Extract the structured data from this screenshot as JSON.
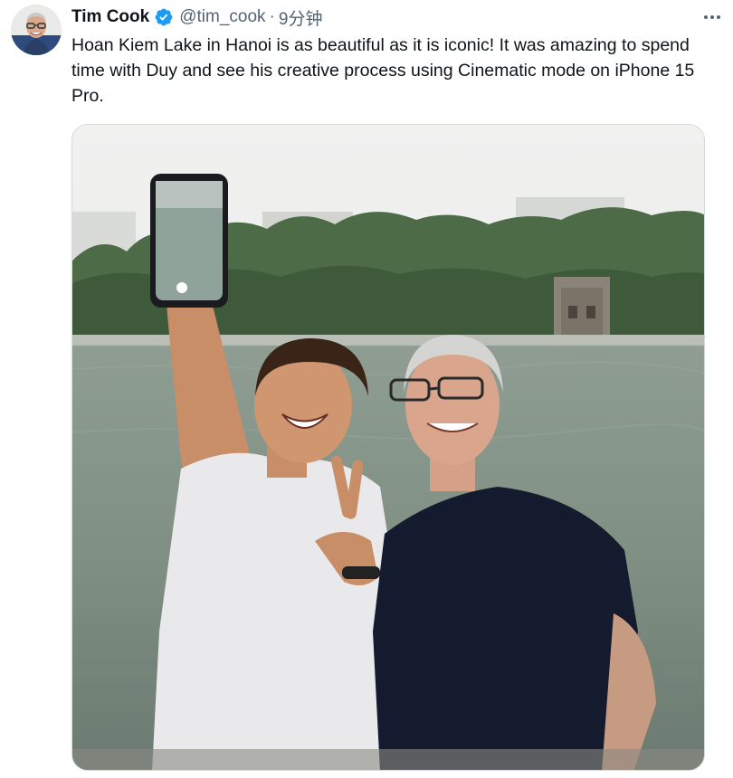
{
  "tweet": {
    "author": {
      "display_name": "Tim Cook",
      "handle": "@tim_cook",
      "verified": true,
      "verified_color": "#1d9bf0"
    },
    "separator": "·",
    "time": "9分钟",
    "text": "Hoan Kiem Lake in Hanoi is as beautiful as it is iconic! It was amazing to spend time with Duy and see his creative process using Cinematic mode on iPhone 15 Pro.",
    "more_icon": "ellipsis-icon"
  },
  "colors": {
    "text_primary": "#0f1419",
    "text_secondary": "#536471",
    "border": "#cfd9de"
  }
}
